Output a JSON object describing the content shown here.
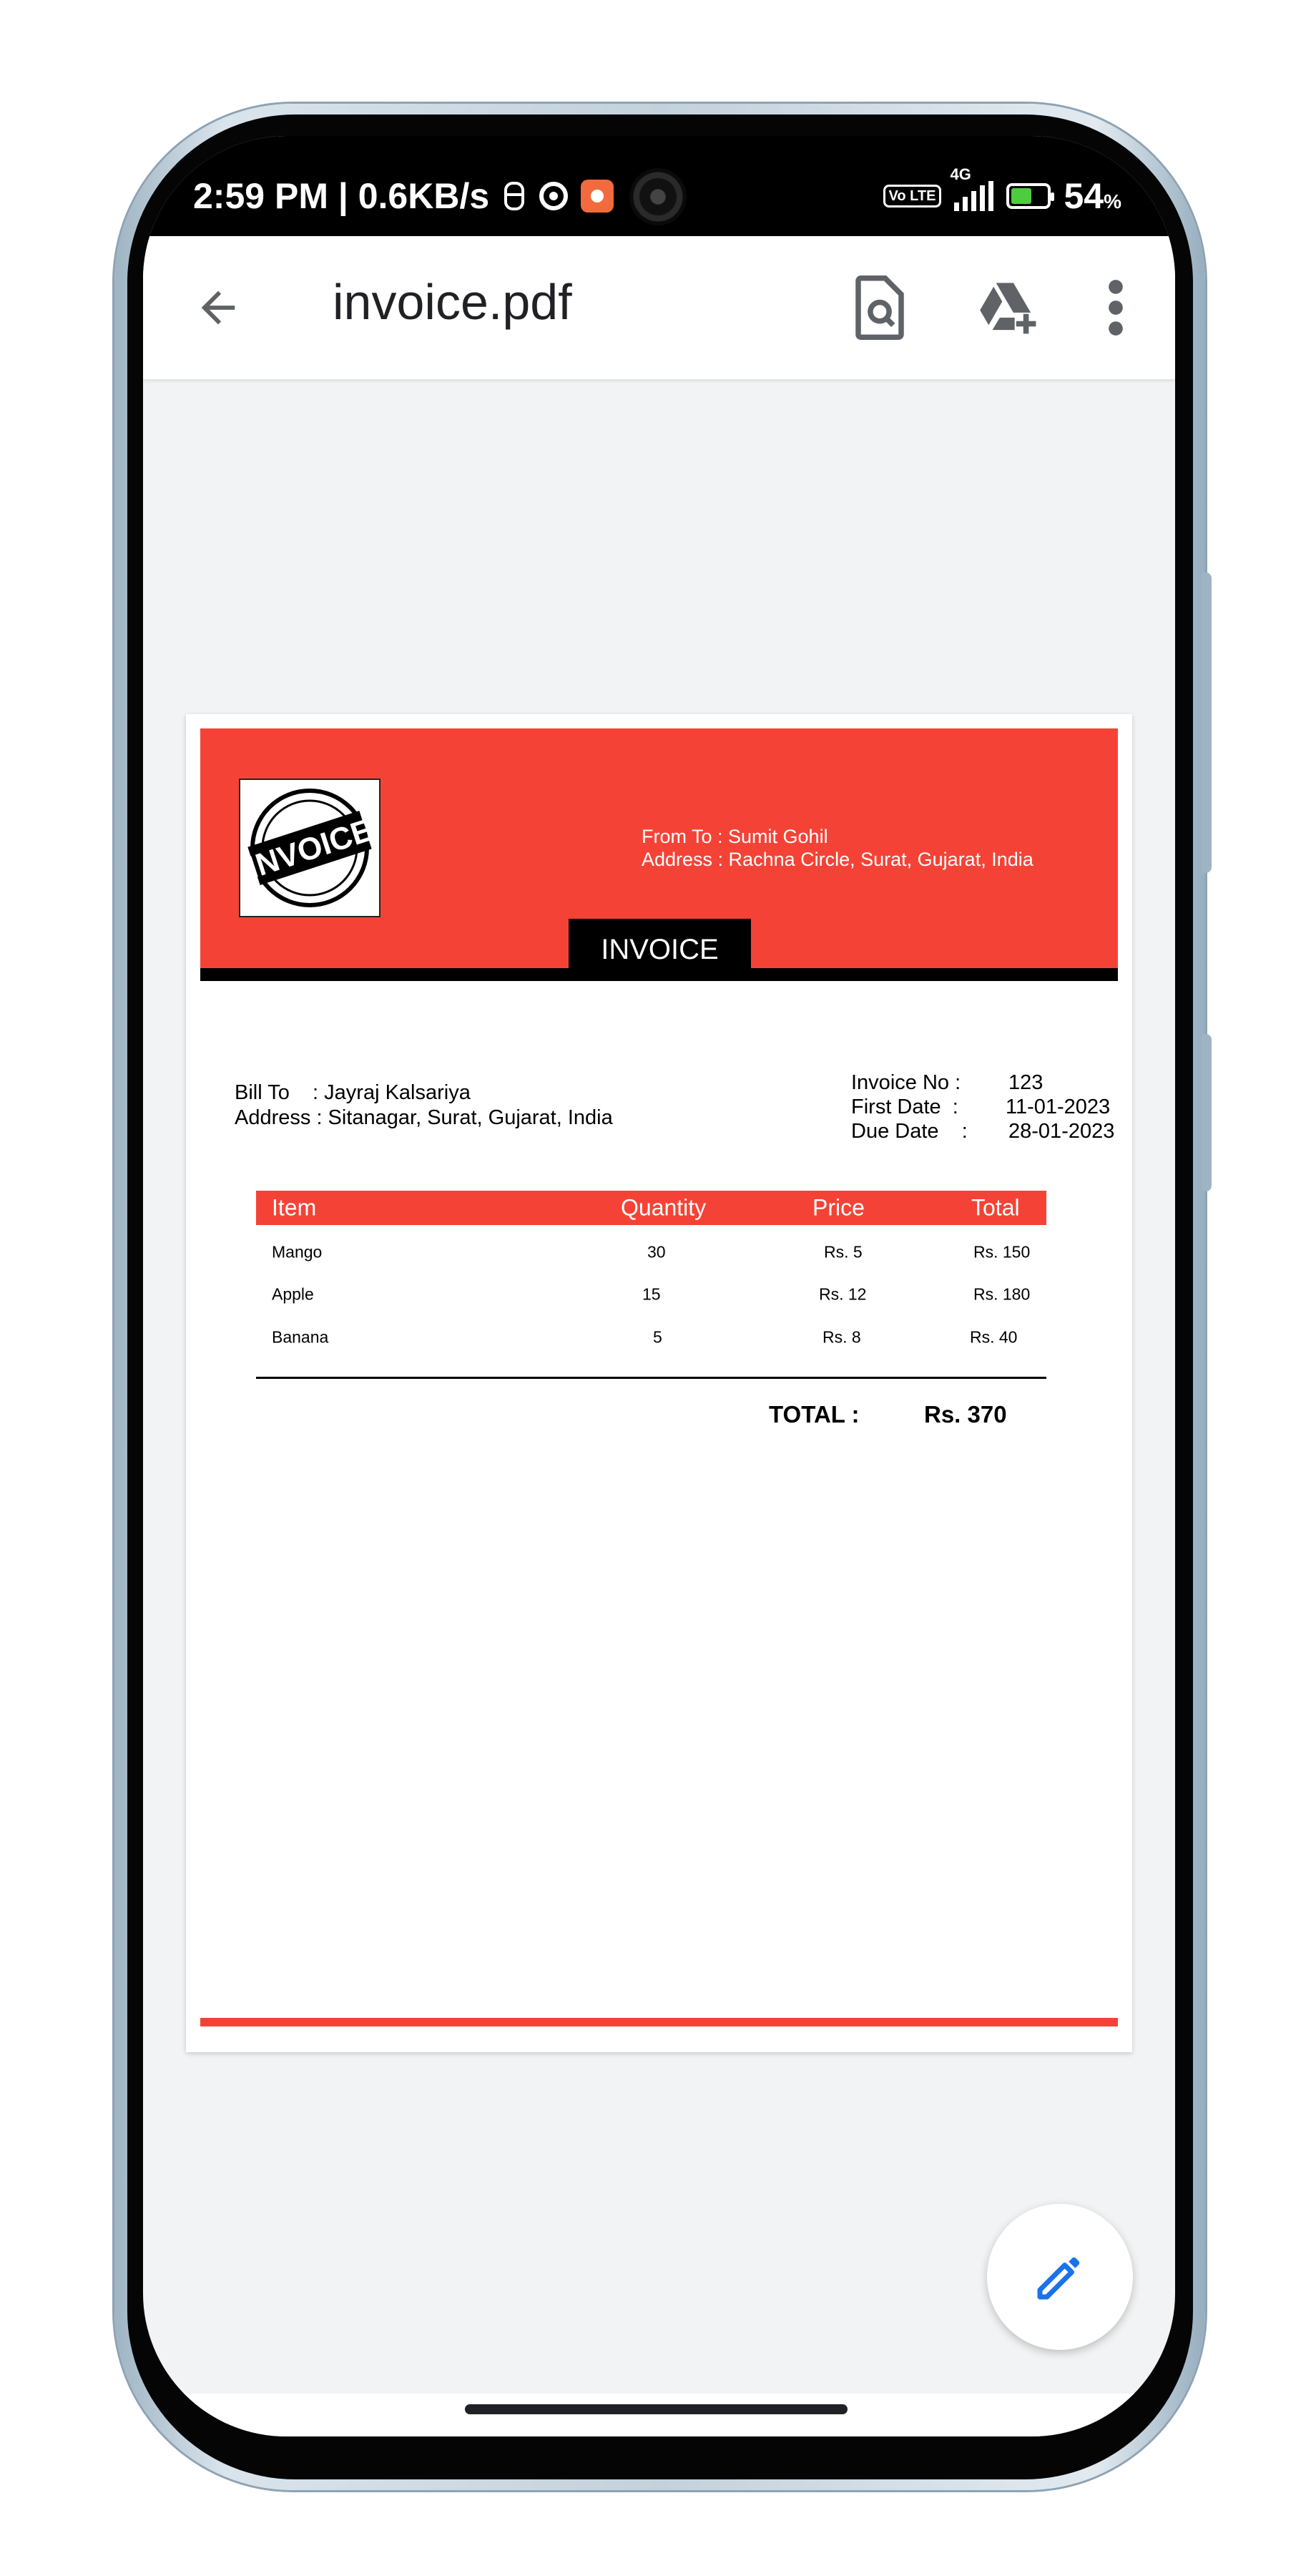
{
  "status_bar": {
    "time_speed": "2:59 PM | 0.6KB/s",
    "network": "4G",
    "volte": "Vo LTE",
    "battery_pct": "54",
    "battery_unit": "%"
  },
  "app_bar": {
    "title": "invoice.pdf",
    "icons": [
      "back-arrow-icon",
      "find-in-page-icon",
      "add-to-drive-icon",
      "more-vert-icon"
    ]
  },
  "invoice": {
    "logo_text": "INVOICE",
    "from_line": "From To : Sumit Gohil",
    "from_address": "Address : Rachna Circle, Surat, Gujarat, India",
    "heading": "INVOICE",
    "bill_to": "Bill To    : Jayraj Kalsariya",
    "bill_address": "Address : Sitanagar, Surat, Gujarat, India",
    "meta": [
      {
        "label": "Invoice No :",
        "value": "123"
      },
      {
        "label": "First Date  :",
        "value": "11-01-2023"
      },
      {
        "label": "Due Date    :",
        "value": "28-01-2023"
      }
    ],
    "table": {
      "headers": [
        "Item",
        "Quantity",
        "Price",
        "Total"
      ],
      "rows": [
        [
          "Mango",
          "30",
          "Rs. 5",
          "Rs. 150"
        ],
        [
          "Apple",
          "15",
          "Rs. 12",
          "Rs. 180"
        ],
        [
          "Banana",
          "5",
          "Rs. 8",
          "Rs. 40"
        ]
      ]
    },
    "total_label": "TOTAL :",
    "total_value": "Rs. 370"
  },
  "fab": {
    "icon": "edit-pencil-icon"
  },
  "colors": {
    "accent": "#f44336",
    "fab_icon": "#1a73e8"
  }
}
